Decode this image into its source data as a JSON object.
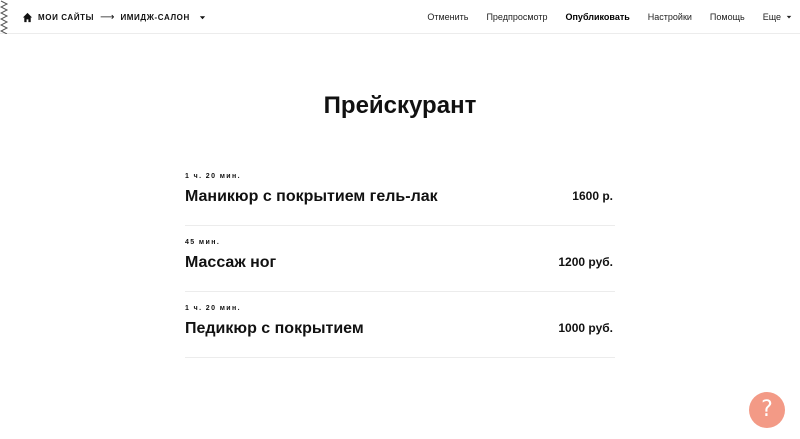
{
  "breadcrumb": {
    "root_label": "Мои сайты",
    "arrow": "⟶",
    "site_label": "Имидж-салон"
  },
  "nav": {
    "undo": "Отменить",
    "preview": "Предпросмотр",
    "publish": "Опубликовать",
    "settings": "Настройки",
    "help": "Помощь",
    "more": "Еще"
  },
  "page": {
    "title": "Прейскурант"
  },
  "services": [
    {
      "duration": "1 ч. 20 мин.",
      "name": "Маникюр с покрытием гель-лак",
      "price": "1600 р."
    },
    {
      "duration": "45 мин.",
      "name": "Массаж ног",
      "price": "1200 руб."
    },
    {
      "duration": "1 ч. 20 мин.",
      "name": "Педикюр с покрытием",
      "price": "1000 руб."
    }
  ],
  "help_button": {
    "glyph": "?",
    "color": "#f39a86"
  }
}
